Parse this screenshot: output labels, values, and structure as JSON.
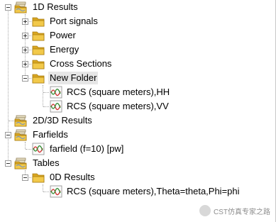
{
  "tree": {
    "results_1d": "1D Results",
    "port_signals": "Port signals",
    "power": "Power",
    "energy": "Energy",
    "cross_sections": "Cross Sections",
    "new_folder": "New Folder",
    "rcs_hh": "RCS (square meters),HH",
    "rcs_vv": "RCS (square meters),VV",
    "results_2d3d": "2D/3D Results",
    "farfields": "Farfields",
    "farfield_item": "farfield (f=10) [pw]",
    "tables": "Tables",
    "results_0d": "0D Results",
    "rcs_theta_phi": "RCS (square meters),Theta=theta,Phi=phi"
  },
  "watermark": "CST仿真专家之路",
  "colors": {
    "folder_yellow": "#e8b830",
    "selection_bg": "#e6e6e6",
    "signal_red": "#d12b2b",
    "signal_green": "#2e8b2e"
  }
}
